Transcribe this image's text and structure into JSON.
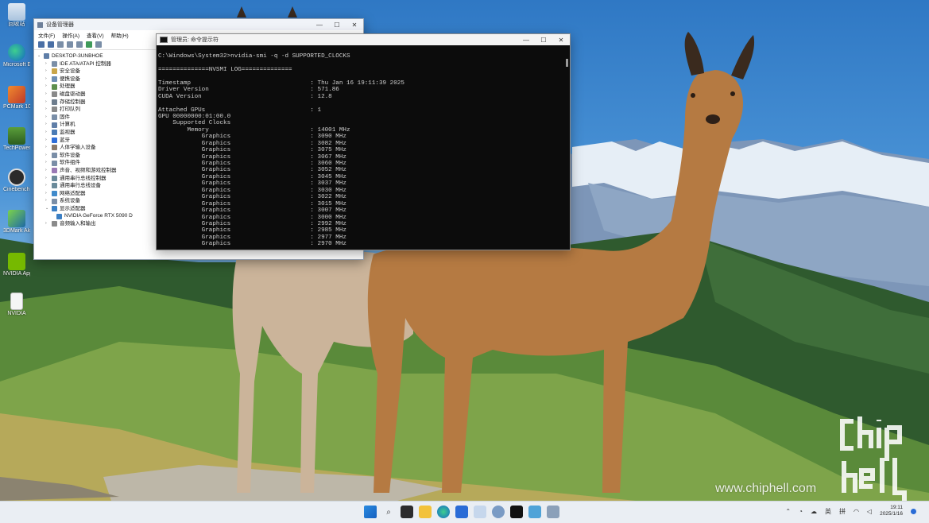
{
  "desktop_icons": [
    {
      "label": "回收站",
      "icon": "recycle-bin-icon"
    },
    {
      "label": "Microsoft Edge",
      "icon": "edge-icon"
    },
    {
      "label": "PCMark 10 2024",
      "icon": "pcmark-icon"
    },
    {
      "label": "TechPowerUp",
      "icon": "gpuz-icon"
    },
    {
      "label": "Cinebench R23",
      "icon": "cinebench-icon"
    },
    {
      "label": "3DMark Akashi Suite",
      "icon": "3dmark-icon"
    },
    {
      "label": "NVIDIA App",
      "icon": "nvidia-icon"
    },
    {
      "label": "NVIDIA",
      "icon": "file-icon"
    }
  ],
  "device_manager": {
    "title": "设备管理器",
    "menu": [
      "文件(F)",
      "操作(A)",
      "查看(V)",
      "帮助(H)"
    ],
    "root": "DESKTOP-3UNBHOE",
    "categories": [
      "IDE ATA/ATAPI 控制器",
      "安全设备",
      "便携设备",
      "处理器",
      "磁盘驱动器",
      "存储控制器",
      "打印队列",
      "固件",
      "计算机",
      "监视器",
      "蓝牙",
      "人体学输入设备",
      "软件设备",
      "软件组件",
      "声音、视频和游戏控制器",
      "通用串行总线控制器",
      "通用串行总线设备",
      "网络适配器",
      "系统设备",
      "显示适配器"
    ],
    "gpu_device": "NVIDIA GeForce RTX 5090 D",
    "last_category": "音频输入和输出"
  },
  "cmd": {
    "title": "管理员: 命令提示符",
    "lines": [
      "C:\\Windows\\System32>nvidia-smi -q -d SUPPORTED_CLOCKS",
      "",
      "==============NVSMI LOG==============",
      "",
      "Timestamp                                 : Thu Jan 16 19:11:39 2025",
      "Driver Version                            : 571.86",
      "CUDA Version                              : 12.8",
      "",
      "Attached GPUs                             : 1",
      "GPU 00000000:01:00.0",
      "    Supported Clocks",
      "        Memory                            : 14001 MHz",
      "            Graphics                      : 3090 MHz",
      "            Graphics                      : 3082 MHz",
      "            Graphics                      : 3075 MHz",
      "            Graphics                      : 3067 MHz",
      "            Graphics                      : 3060 MHz",
      "            Graphics                      : 3052 MHz",
      "            Graphics                      : 3045 MHz",
      "            Graphics                      : 3037 MHz",
      "            Graphics                      : 3030 MHz",
      "            Graphics                      : 3022 MHz",
      "            Graphics                      : 3015 MHz",
      "            Graphics                      : 3007 MHz",
      "            Graphics                      : 3000 MHz",
      "            Graphics                      : 2992 MHz",
      "            Graphics                      : 2985 MHz",
      "            Graphics                      : 2977 MHz",
      "            Graphics                      : 2970 MHz"
    ]
  },
  "watermark": {
    "url": "www.chiphell.com",
    "logo_text": "chip hell"
  },
  "taskbar": {
    "icons": [
      "start-icon",
      "search-icon",
      "task-view-icon",
      "file-explorer-icon",
      "edge-icon",
      "store-icon",
      "photos-icon",
      "settings-icon",
      "terminal-icon",
      "notepad-icon",
      "device-manager-icon"
    ],
    "tray_lang": "拼",
    "tray_ime": "英",
    "time": "19:11",
    "date": "2025/1/16"
  }
}
